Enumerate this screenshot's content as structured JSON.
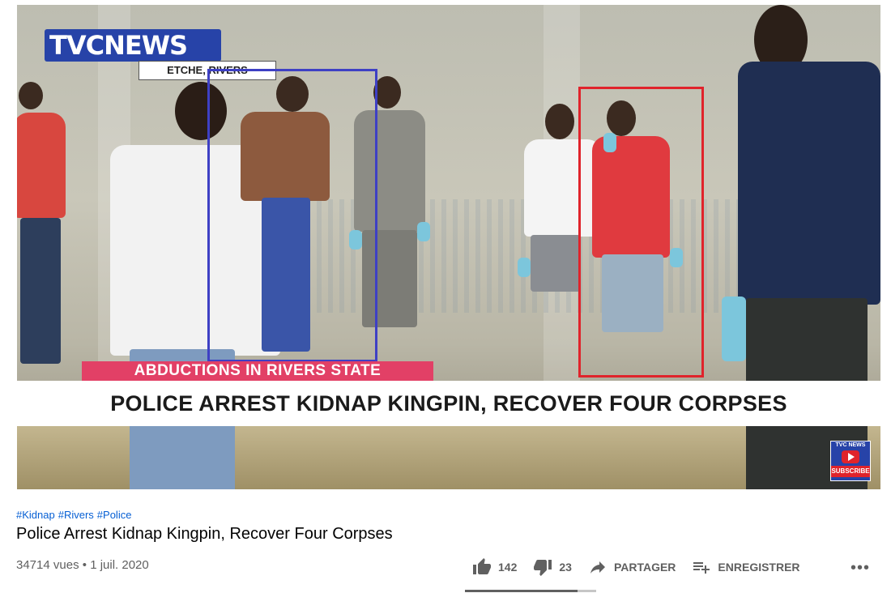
{
  "video": {
    "logo": "TVCNEWS",
    "location": "ETCHE, RIVERS",
    "tag_banner": "ABDUCTIONS IN RIVERS STATE",
    "headline": "POLICE ARREST KIDNAP KINGPIN, RECOVER FOUR CORPSES",
    "subscribe_badge": {
      "top": "TVC NEWS",
      "bottom": "SUBSCRIBE"
    },
    "highlight_boxes": {
      "blue": "#3e40c4",
      "red": "#e0232b"
    }
  },
  "info": {
    "hashtags": [
      "#Kidnap",
      "#Rivers",
      "#Police"
    ],
    "title": "Police Arrest Kidnap Kingpin, Recover Four Corpses",
    "views": "34714 vues",
    "separator": "•",
    "date": "1 juil. 2020"
  },
  "actions": {
    "likes": "142",
    "dislikes": "23",
    "share_label": "PARTAGER",
    "save_label": "ENREGISTRER",
    "more": "•••",
    "like_ratio": 0.86
  },
  "colors": {
    "link": "#065fd4",
    "accent_red": "#e0232b",
    "brand_blue": "#2743a8"
  },
  "icons": [
    "thumb-up-icon",
    "thumb-down-icon",
    "share-icon",
    "playlist-add-icon",
    "more-icon"
  ]
}
